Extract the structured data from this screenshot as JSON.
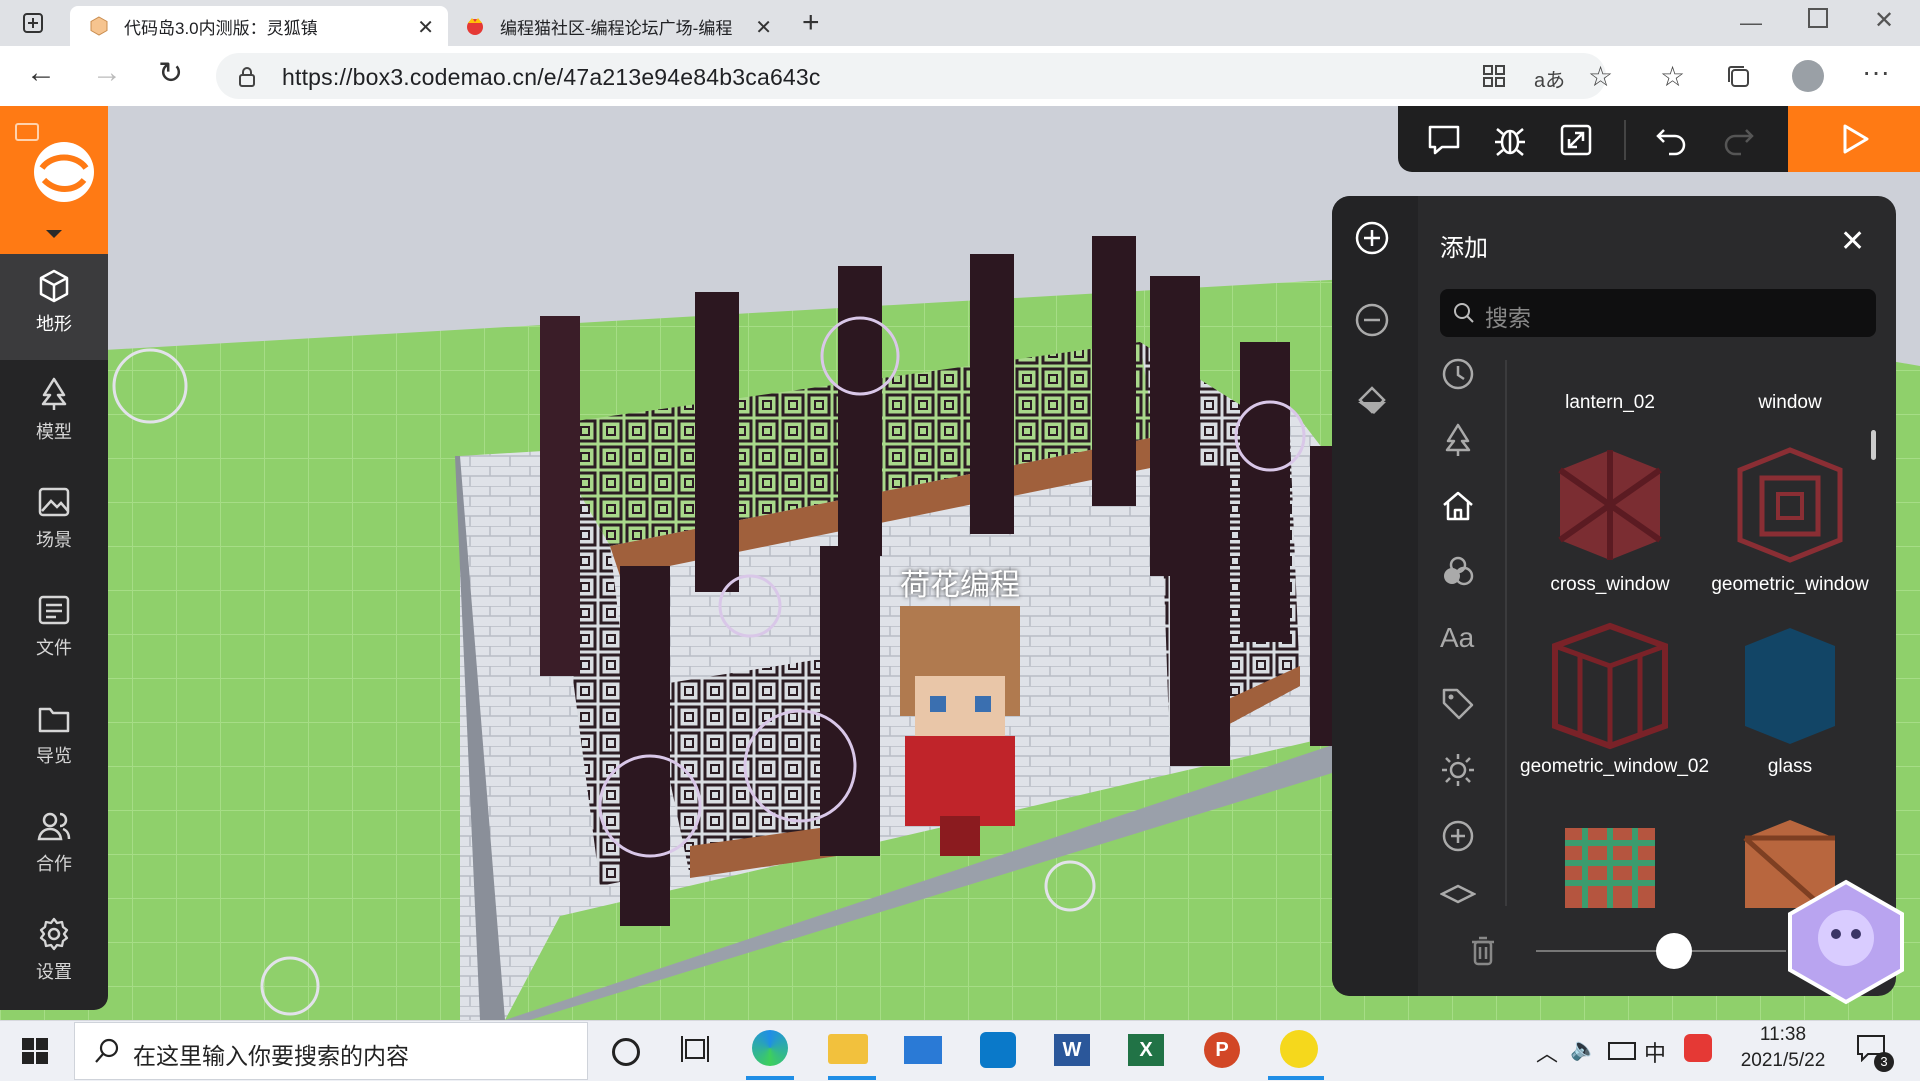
{
  "browser": {
    "tabs": [
      {
        "title": "代码岛3.0内测版：灵狐镇",
        "active": true
      },
      {
        "title": "编程猫社区-编程论坛广场-编程",
        "active": false
      }
    ],
    "url": "https://box3.codemao.cn/e/47a213e94e84b3ca643c",
    "read_aloud_label": "aあ",
    "window_controls": [
      "minimize",
      "restore",
      "close"
    ]
  },
  "sidebar": {
    "items": [
      {
        "label": "地形",
        "icon": "cube-icon",
        "active": true
      },
      {
        "label": "模型",
        "icon": "tree-icon",
        "active": false
      },
      {
        "label": "场景",
        "icon": "image-icon",
        "active": false
      },
      {
        "label": "文件",
        "icon": "file-icon",
        "active": false
      },
      {
        "label": "导览",
        "icon": "folder-icon",
        "active": false
      },
      {
        "label": "合作",
        "icon": "users-icon",
        "active": false
      },
      {
        "label": "设置",
        "icon": "gear-icon",
        "active": false
      }
    ]
  },
  "toolbar": {
    "buttons": [
      "chat-icon",
      "bug-icon",
      "resize-icon",
      "undo-icon",
      "redo-icon"
    ],
    "run": "play-icon"
  },
  "scene": {
    "player_name": "荷花编程"
  },
  "add_panel": {
    "title": "添加",
    "search_placeholder": "搜索",
    "categories": [
      "history-icon",
      "tree-icon",
      "house-icon",
      "shapes-icon",
      "text-icon",
      "tag-icon",
      "sun-icon",
      "plus-circle-icon",
      "layers-icon"
    ],
    "items": [
      {
        "name": "lantern_02"
      },
      {
        "name": "window"
      },
      {
        "name": "cross_window"
      },
      {
        "name": "geometric_window"
      },
      {
        "name": "geometric_window_02"
      },
      {
        "name": "glass"
      },
      {
        "name": ""
      },
      {
        "name": ""
      }
    ],
    "slider_value": 0.55
  },
  "taskbar": {
    "search_placeholder": "在这里输入你要搜索的内容",
    "time": "11:38",
    "date": "2021/5/22",
    "ime": "中",
    "notification_count": "3"
  },
  "colors": {
    "accent": "#ff7a14",
    "sidebar_bg": "#252526",
    "panel_bg": "#2a2a2c"
  }
}
